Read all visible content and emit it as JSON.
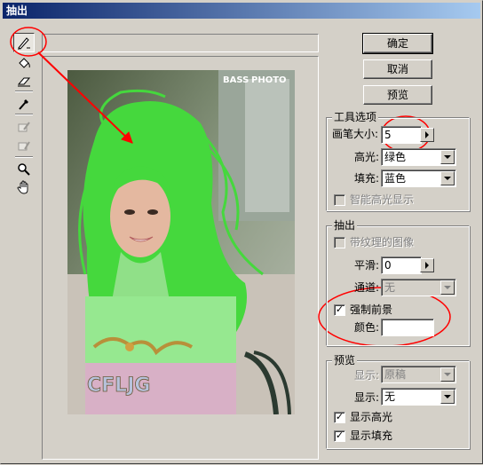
{
  "window": {
    "title": "抽出"
  },
  "tools": [
    {
      "icon": "edge-highlighter-icon",
      "selected": true
    },
    {
      "icon": "fill-bucket-icon"
    },
    {
      "icon": "eraser-icon"
    },
    {
      "icon": "eyedropper-icon"
    },
    {
      "icon": "cleanup-tool-icon"
    },
    {
      "icon": "edge-touchup-icon"
    },
    {
      "icon": "zoom-icon"
    },
    {
      "icon": "hand-icon"
    }
  ],
  "buttons": {
    "ok": "确定",
    "cancel": "取消",
    "preview": "预览"
  },
  "image": {
    "watermark_top": "BASS",
    "watermark_top2": "PHOTO",
    "watermark_bottom": "CFLJG"
  },
  "tool_options": {
    "group_title": "工具选项",
    "brush_size_label": "画笔大小:",
    "brush_size_value": "5",
    "highlight_label": "高光:",
    "highlight_value": "绿色",
    "fill_label": "填充:",
    "fill_value": "蓝色",
    "smart_highlight_label": "智能高光显示"
  },
  "extraction": {
    "group_title": "抽出",
    "textured_image_label": "带纹理的图像",
    "smooth_label": "平滑:",
    "smooth_value": "0",
    "channel_label": "通道:",
    "channel_value": "无",
    "force_foreground_label": "强制前景",
    "force_foreground_checked": true,
    "color_label": "颜色:"
  },
  "preview_group": {
    "group_title": "预览",
    "show_label_1": "显示:",
    "show_value_1": "原稿",
    "show_label_2": "显示:",
    "show_value_2": "无",
    "show_highlight_label": "显示高光",
    "show_highlight_checked": true,
    "show_fill_label": "显示填充",
    "show_fill_checked": true
  },
  "colors": {
    "highlight": "#3ee23a",
    "annotation": "#ff0000",
    "titlebar": "#0a246a"
  }
}
